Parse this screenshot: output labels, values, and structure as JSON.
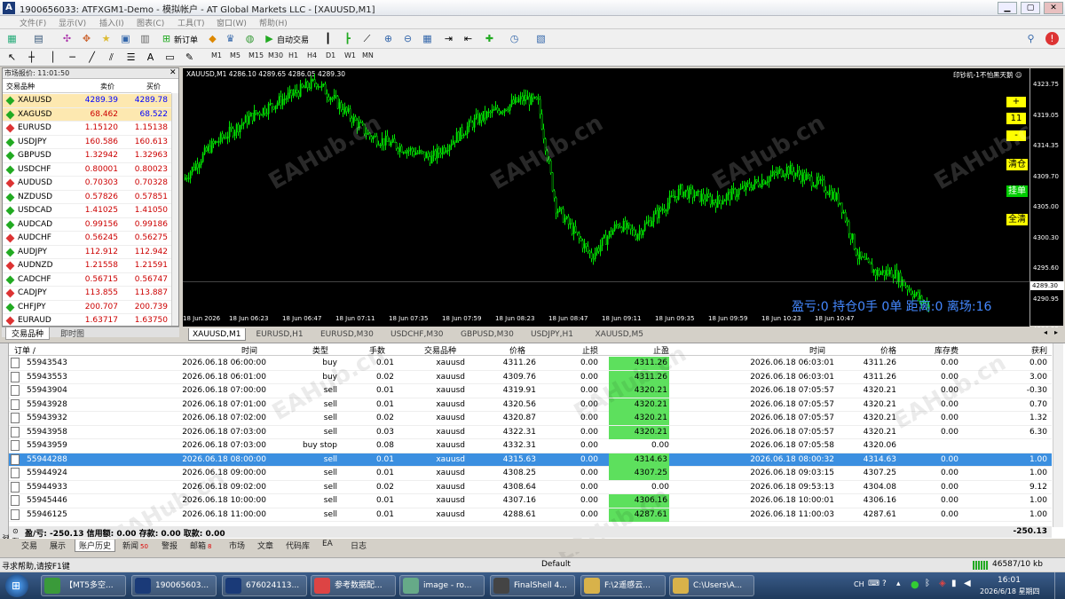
{
  "window": {
    "title": "1900656033: ATFXGM1-Demo - 模拟帐户 - AT Global Markets LLC - [XAUUSD,M1]",
    "icon_letter": "A",
    "btn_min": "▁",
    "btn_max": "▢",
    "btn_close": "✕"
  },
  "menu": [
    "文件(F)",
    "显示(V)",
    "插入(I)",
    "图表(C)",
    "工具(T)",
    "窗口(W)",
    "帮助(H)"
  ],
  "toolbar": {
    "new_order": "新订单",
    "auto_trade": "自动交易",
    "timeframes": [
      "M1",
      "M5",
      "M15",
      "M30",
      "H1",
      "H4",
      "D1",
      "W1",
      "MN"
    ]
  },
  "market_watch": {
    "title": "市场报价: 11:01:50",
    "headers": {
      "symbol": "交易品种",
      "bid": "卖价",
      "ask": "买价"
    },
    "rows": [
      {
        "symbol": "XAUUSD",
        "bid": "4289.39",
        "ask": "4289.78"
      },
      {
        "symbol": "XAGUSD",
        "bid": "68.462",
        "ask": "68.522"
      },
      {
        "symbol": "EURUSD",
        "bid": "1.15120",
        "ask": "1.15138"
      },
      {
        "symbol": "USDJPY",
        "bid": "160.586",
        "ask": "160.613"
      },
      {
        "symbol": "GBPUSD",
        "bid": "1.32942",
        "ask": "1.32963"
      },
      {
        "symbol": "USDCHF",
        "bid": "0.80001",
        "ask": "0.80023"
      },
      {
        "symbol": "AUDUSD",
        "bid": "0.70303",
        "ask": "0.70328"
      },
      {
        "symbol": "NZDUSD",
        "bid": "0.57826",
        "ask": "0.57851"
      },
      {
        "symbol": "USDCAD",
        "bid": "1.41025",
        "ask": "1.41050"
      },
      {
        "symbol": "AUDCAD",
        "bid": "0.99156",
        "ask": "0.99186"
      },
      {
        "symbol": "AUDCHF",
        "bid": "0.56245",
        "ask": "0.56275"
      },
      {
        "symbol": "AUDJPY",
        "bid": "112.912",
        "ask": "112.942"
      },
      {
        "symbol": "AUDNZD",
        "bid": "1.21558",
        "ask": "1.21591"
      },
      {
        "symbol": "CADCHF",
        "bid": "0.56715",
        "ask": "0.56747"
      },
      {
        "symbol": "CADJPY",
        "bid": "113.855",
        "ask": "113.887"
      },
      {
        "symbol": "CHFJPY",
        "bid": "200.707",
        "ask": "200.739"
      },
      {
        "symbol": "EURAUD",
        "bid": "1.63717",
        "ask": "1.63750"
      }
    ],
    "tabs": [
      "交易品种",
      "即时图"
    ]
  },
  "chart": {
    "header": "XAUUSD,M1  4286.10 4289.65 4286.05 4289.30",
    "ea_label": "印钞机-1不怕黑天鹅 ☺",
    "y_ticks": [
      "4323.75",
      "4319.05",
      "4314.35",
      "4309.70",
      "4305.00",
      "4300.30",
      "4295.60",
      "4290.95",
      "4286.25"
    ],
    "price_tag": "4289.30",
    "x_ticks": [
      "18 Jun 2026",
      "18 Jun 06:23",
      "18 Jun 06:47",
      "18 Jun 07:11",
      "18 Jun 07:35",
      "18 Jun 07:59",
      "18 Jun 08:23",
      "18 Jun 08:47",
      "18 Jun 09:11",
      "18 Jun 09:35",
      "18 Jun 09:59",
      "18 Jun 10:23",
      "18 Jun 10:47"
    ],
    "buttons": {
      "plus": "+",
      "lot": "11",
      "minus": "-",
      "close_all": "清仓",
      "pending": "挂单",
      "clear_all": "全清"
    },
    "status_text": "盈亏:0  持仓0手 0单  距离:0 离场:16",
    "tabs": [
      "XAUUSD,M1",
      "EURUSD,H1",
      "EURUSD,M30",
      "USDCHF,M30",
      "GBPUSD,M30",
      "USDJPY,H1",
      "XAUUSD,M5"
    ],
    "colors": {
      "bull": "#00e000",
      "bear": "#00e000",
      "bg": "#000000"
    }
  },
  "terminal": {
    "headers": [
      "订单 /",
      "时间",
      "类型",
      "手数",
      "交易品种",
      "价格",
      "止损",
      "止盈",
      "时间",
      "价格",
      "库存费",
      "获利"
    ],
    "rows": [
      [
        "55943543",
        "2026.06.18 06:00:00",
        "buy",
        "0.01",
        "xauusd",
        "4311.26",
        "0.00",
        "4311.26",
        "2026.06.18 06:03:01",
        "4311.26",
        "0.00",
        "0.00"
      ],
      [
        "55943553",
        "2026.06.18 06:01:00",
        "buy",
        "0.02",
        "xauusd",
        "4309.76",
        "0.00",
        "4311.26",
        "2026.06.18 06:03:01",
        "4311.26",
        "0.00",
        "3.00"
      ],
      [
        "55943904",
        "2026.06.18 07:00:00",
        "sell",
        "0.01",
        "xauusd",
        "4319.91",
        "0.00",
        "4320.21",
        "2026.06.18 07:05:57",
        "4320.21",
        "0.00",
        "-0.30"
      ],
      [
        "55943928",
        "2026.06.18 07:01:00",
        "sell",
        "0.01",
        "xauusd",
        "4320.56",
        "0.00",
        "4320.21",
        "2026.06.18 07:05:57",
        "4320.21",
        "0.00",
        "0.70"
      ],
      [
        "55943932",
        "2026.06.18 07:02:00",
        "sell",
        "0.02",
        "xauusd",
        "4320.87",
        "0.00",
        "4320.21",
        "2026.06.18 07:05:57",
        "4320.21",
        "0.00",
        "1.32"
      ],
      [
        "55943958",
        "2026.06.18 07:03:00",
        "sell",
        "0.03",
        "xauusd",
        "4322.31",
        "0.00",
        "4320.21",
        "2026.06.18 07:05:57",
        "4320.21",
        "0.00",
        "6.30"
      ],
      [
        "55943959",
        "2026.06.18 07:03:00",
        "buy stop",
        "0.08",
        "xauusd",
        "4332.31",
        "0.00",
        "0.00",
        "2026.06.18 07:05:58",
        "4320.06",
        "",
        ""
      ],
      [
        "55944288",
        "2026.06.18 08:00:00",
        "sell",
        "0.01",
        "xauusd",
        "4315.63",
        "0.00",
        "4314.63",
        "2026.06.18 08:00:32",
        "4314.63",
        "0.00",
        "1.00"
      ],
      [
        "55944924",
        "2026.06.18 09:00:00",
        "sell",
        "0.01",
        "xauusd",
        "4308.25",
        "0.00",
        "4307.25",
        "2026.06.18 09:03:15",
        "4307.25",
        "0.00",
        "1.00"
      ],
      [
        "55944933",
        "2026.06.18 09:02:00",
        "sell",
        "0.02",
        "xauusd",
        "4308.64",
        "0.00",
        "0.00",
        "2026.06.18 09:53:13",
        "4304.08",
        "0.00",
        "9.12"
      ],
      [
        "55945446",
        "2026.06.18 10:00:00",
        "sell",
        "0.01",
        "xauusd",
        "4307.16",
        "0.00",
        "4306.16",
        "2026.06.18 10:00:01",
        "4306.16",
        "0.00",
        "1.00"
      ],
      [
        "55946125",
        "2026.06.18 11:00:00",
        "sell",
        "0.01",
        "xauusd",
        "4288.61",
        "0.00",
        "4287.61",
        "2026.06.18 11:00:03",
        "4287.61",
        "0.00",
        "1.00"
      ]
    ],
    "highlight_tp": [
      true,
      true,
      true,
      true,
      true,
      true,
      false,
      true,
      true,
      false,
      true,
      true
    ],
    "selected_row": 7,
    "balance_text": "盈/亏: -250.13  信用额: 0.00  存款: 0.00  取款: 0.00",
    "balance_value": "-250.13",
    "side_label": "终端"
  },
  "bottom_tabs": [
    {
      "label": "交易",
      "badge": ""
    },
    {
      "label": "展示",
      "badge": ""
    },
    {
      "label": "账户历史",
      "badge": ""
    },
    {
      "label": "新闻",
      "badge": "50"
    },
    {
      "label": "警报",
      "badge": ""
    },
    {
      "label": "邮箱",
      "badge": "8"
    },
    {
      "label": "市场",
      "badge": ""
    },
    {
      "label": "文章",
      "badge": ""
    },
    {
      "label": "代码库",
      "badge": ""
    },
    {
      "label": "EA",
      "badge": ""
    },
    {
      "label": "日志",
      "badge": ""
    }
  ],
  "statusbar": {
    "help": "寻求帮助,请按F1键",
    "profile": "Default",
    "traffic": "46587/10 kb"
  },
  "taskbar": {
    "items": [
      {
        "label": "【MT5多空...",
        "color": "#3a9a3a"
      },
      {
        "label": "190065603...",
        "color": "#1a3a78"
      },
      {
        "label": "676024113...",
        "color": "#1a3a78"
      },
      {
        "label": "参考数据配...",
        "color": "#d44"
      },
      {
        "label": "image - ro...",
        "color": "#6a8"
      },
      {
        "label": "FinalShell 4...",
        "color": "#444"
      },
      {
        "label": "F:\\2遥感云...",
        "color": "#d8b24a"
      },
      {
        "label": "C:\\Users\\A...",
        "color": "#d8b24a"
      }
    ],
    "tray_lang": "CH",
    "clock_time": "16:01",
    "clock_date": "2026/6/18 星期四"
  },
  "watermark": "EAHub.cn"
}
